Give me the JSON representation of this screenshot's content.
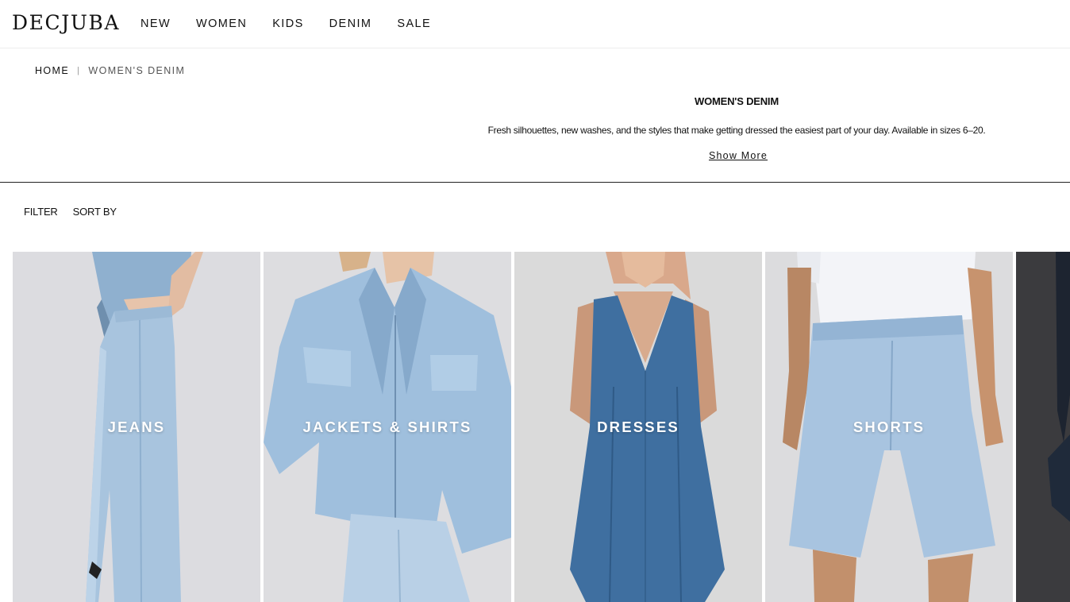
{
  "brand": {
    "name": "DECJUBA"
  },
  "nav": {
    "items": [
      {
        "label": "NEW"
      },
      {
        "label": "WOMEN"
      },
      {
        "label": "KIDS"
      },
      {
        "label": "DENIM"
      },
      {
        "label": "SALE"
      }
    ]
  },
  "breadcrumb": {
    "home": "HOME",
    "separator": "|",
    "current": "WOMEN'S DENIM"
  },
  "intro": {
    "title": "WOMEN'S DENIM",
    "description": "Fresh silhouettes, new washes, and the styles that make getting dressed the easiest part of your day. Available in sizes 6–20.",
    "show_more": "Show More"
  },
  "toolbar": {
    "filter": "FILTER",
    "sort": "SORT BY"
  },
  "categories": [
    {
      "label": "JEANS",
      "icon": "jeans-photo"
    },
    {
      "label": "JACKETS & SHIRTS",
      "icon": "denim-jacket-photo"
    },
    {
      "label": "DRESSES",
      "icon": "denim-dress-photo"
    },
    {
      "label": "SHORTS",
      "icon": "denim-shorts-photo"
    },
    {
      "label": "",
      "icon": "dark-denim-photo"
    }
  ],
  "colors": {
    "tile_background": "#dcdcde",
    "light_denim": "#a9c4de",
    "mid_denim": "#3f6f9e",
    "dark_tile": "#3b3b3d"
  }
}
